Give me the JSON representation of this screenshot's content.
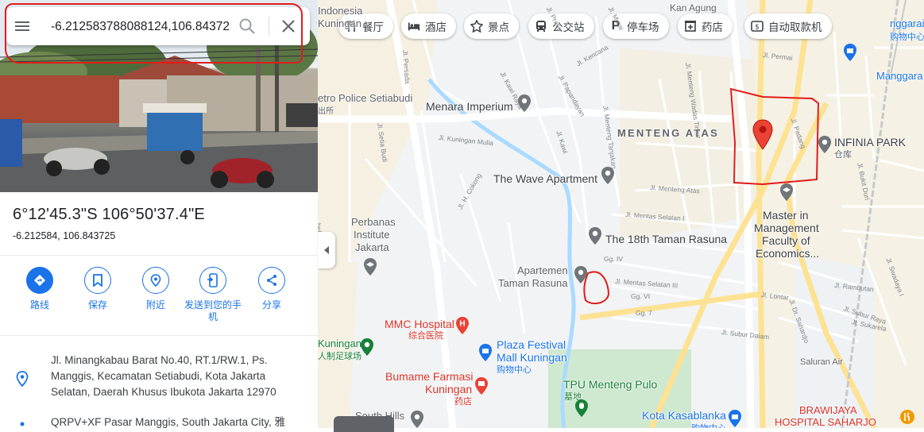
{
  "search": {
    "value": "-6.212583788088124,106.843725",
    "placeholder": ""
  },
  "place": {
    "title": "6°12'45.3\"S 106°50'37.4\"E",
    "decimal": "-6.212584, 106.843725"
  },
  "actions": [
    {
      "label": "路线",
      "icon": "directions-icon"
    },
    {
      "label": "保存",
      "icon": "bookmark-icon"
    },
    {
      "label": "附近",
      "icon": "nearby-icon"
    },
    {
      "label": "发送到您的手机",
      "icon": "send-to-phone-icon"
    },
    {
      "label": "分享",
      "icon": "share-icon"
    }
  ],
  "info": {
    "address": "Jl. Minangkabau Barat No.40, RT.1/RW.1, Ps. Manggis, Kecamatan Setiabudi, Kota Jakarta Selatan, Daerah Khusus Ibukota Jakarta 12970",
    "pluscode": "QRPV+XF Pasar Manggis, South Jakarta City, 雅"
  },
  "chips": [
    {
      "label": "餐厅",
      "icon": "restaurant-icon"
    },
    {
      "label": "酒店",
      "icon": "hotel-icon"
    },
    {
      "label": "景点",
      "icon": "attraction-icon"
    },
    {
      "label": "公交站",
      "icon": "bus-stop-icon"
    },
    {
      "label": "停车场",
      "icon": "parking-icon"
    },
    {
      "label": "药店",
      "icon": "pharmacy-icon"
    },
    {
      "label": "自动取款机",
      "icon": "atm-icon"
    }
  ],
  "map": {
    "district": "MENTENG ATAS",
    "places": {
      "menara_imperium": "Menara Imperium",
      "wave_apartment": "The Wave Apartment",
      "taman_rasuna_18": "The 18th Taman Rasuna",
      "perbanas_1": "Perbanas",
      "perbanas_2": "Institute",
      "perbanas_3": "Jakarta",
      "apartemen_1": "Apartemen",
      "apartemen_2": "Taman Rasuna",
      "mmc_1": "MMC Hospital",
      "mmc_2": "综合医院",
      "plaza_1": "Plaza Festival",
      "plaza_2": "Mall Kuningan",
      "plaza_3": "购物中心",
      "bumame_1": "Bumame Farmasi",
      "bumame_2": "Kuningan",
      "bumame_3": "药店",
      "tpu_1": "TPU Menteng Pulo",
      "tpu_2": "墓地",
      "kasablanka_1": "Kota Kasablanka",
      "kasablanka_2": "购物中心",
      "infinia_1": "INFINIA PARK",
      "infinia_2": "仓库",
      "master_1": "Master in",
      "master_2": "Management",
      "master_3": "Faculty of",
      "master_4": "Economics...",
      "indonesia": "Indonesia",
      "kuningan_top": "Kuningan",
      "police": "etro Police Setiabudi",
      "police_2": "出所",
      "kuningan_left_1": "Kuningan",
      "kuningan_left_2": "人制足球场",
      "south_hills": "South Hills",
      "brawijaya_1": "BRAWIJAYA",
      "brawijaya_2": "HOSPITAL SAHARJO",
      "manggarai_1": "nggarai",
      "manggarai_2": "购物中心",
      "manggarai_3": "Manggara",
      "agung": "Kan Agung",
      "saluran_air": "Saluran Air"
    },
    "streets": {
      "kuningan_mulia": "Jl. Kuningan Mulia",
      "kawi": "Jl. Kawi",
      "menteng_atas": "Jl. Menteng Atas",
      "mentas_selatan": "Jl. Mentas Selatan I",
      "mentas_selatan_3": "Jl. Mentas Selatan III",
      "dr_sahardjo": "Jl. Dr. Sahardjo",
      "rambutan": "Jl. Rambutan",
      "padang": "Jl. Padang",
      "permai": "Jl. Permai",
      "setia_budi": "Jl. Setia Budi",
      "h_cokong": "Jl. H. Cokong",
      "lontar": "Jl. Lontar",
      "subur_dalam": "Jl. Subur Dalam",
      "subur_raya": "Jl. Subur Raya",
      "sukarela": "Jl. Sukarela",
      "swadaya": "Jl. Swadaya I",
      "bukit_duri": "Jl. Bukit Duri",
      "papandayan": "Jl. Papandayan",
      "kencana": "Jl. Kencana",
      "kawi_raya": "Jl. Kawi Raya",
      "murai": "Jl. Murai",
      "prahu": "Jl. Prahu",
      "gg_iv": "Gg. IV",
      "gg_vi": "Gg. VI",
      "gg_7": "Gg. 7",
      "menteng_tanjakan": "Jl. Menteng Tanjakan",
      "menteng_wadas": "Jl. Menteng Wadas Timur",
      "persada": "Jl. Persada",
      "bela": "bela Setti"
    }
  },
  "colors": {
    "accent": "#1a73e8",
    "pin_red": "#ea4335",
    "annotation_red": "#e21b1b",
    "map_bg": "#f1f3f4",
    "road_yellow": "#fde293"
  }
}
